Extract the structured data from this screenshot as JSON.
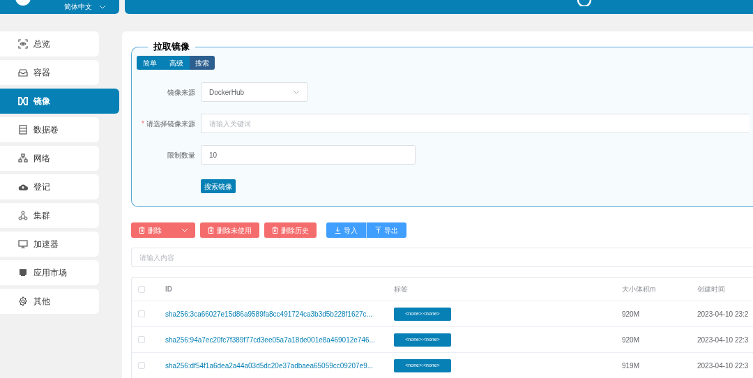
{
  "header": {
    "language": "简体中文"
  },
  "sidebar": {
    "items": [
      {
        "label": "总览",
        "selected": false
      },
      {
        "label": "容器",
        "selected": false
      },
      {
        "label": "镜像",
        "selected": true
      },
      {
        "label": "数据卷",
        "selected": false
      },
      {
        "label": "网络",
        "selected": false
      },
      {
        "label": "登记",
        "selected": false
      },
      {
        "label": "集群",
        "selected": false
      },
      {
        "label": "加速器",
        "selected": false
      },
      {
        "label": "应用市场",
        "selected": false
      },
      {
        "label": "其他",
        "selected": false
      }
    ]
  },
  "pull_panel": {
    "title": "拉取镜像",
    "tabs": [
      {
        "label": "简单",
        "selected": false
      },
      {
        "label": "高级",
        "selected": false
      },
      {
        "label": "搜索",
        "selected": true
      }
    ],
    "fields": [
      {
        "kind": "select",
        "label": "镜像来源",
        "value": "DockerHub"
      },
      {
        "kind": "wide",
        "marker": "*",
        "label": "请选择镜像来源",
        "placeholder": "请输入关键词"
      },
      {
        "kind": "input",
        "label": "限制数量",
        "value": "10"
      }
    ],
    "submit": "搜索镜像"
  },
  "toolbar": {
    "buttons": [
      {
        "label": "删除",
        "kind": "dropdown"
      },
      {
        "label": "删除未使用",
        "kind": "delete"
      },
      {
        "label": "删除历史",
        "kind": "delete"
      },
      {
        "label": "导入",
        "kind": "import"
      },
      {
        "label": "导出",
        "kind": "export"
      }
    ]
  },
  "filter": {
    "placeholder": "请输入内容"
  },
  "table": {
    "all_checked": false,
    "columns": [
      "ID",
      "标签",
      "大小体积m",
      "创建时间"
    ],
    "rows": [
      {
        "checked": false,
        "id": "sha256:3ca66027e15d86a9589fa8cc491724ca3b3d5b228f1627c...",
        "tag": "<none>:<none>",
        "size": "920M",
        "created": "2023-04-10 23:2"
      },
      {
        "checked": false,
        "id": "sha256:94a7ec20fc7f389f77cd3ee05a7a18de001e8a469012e746...",
        "tag": "<none>:<none>",
        "size": "920M",
        "created": "2023-04-10 22:3"
      },
      {
        "checked": false,
        "id": "sha256:df54f1a6dea2a44a03d5dc20e37adbaea65059cc09207e9...",
        "tag": "<none>:<none>",
        "size": "919M",
        "created": "2023-04-10 22:3"
      }
    ]
  }
}
